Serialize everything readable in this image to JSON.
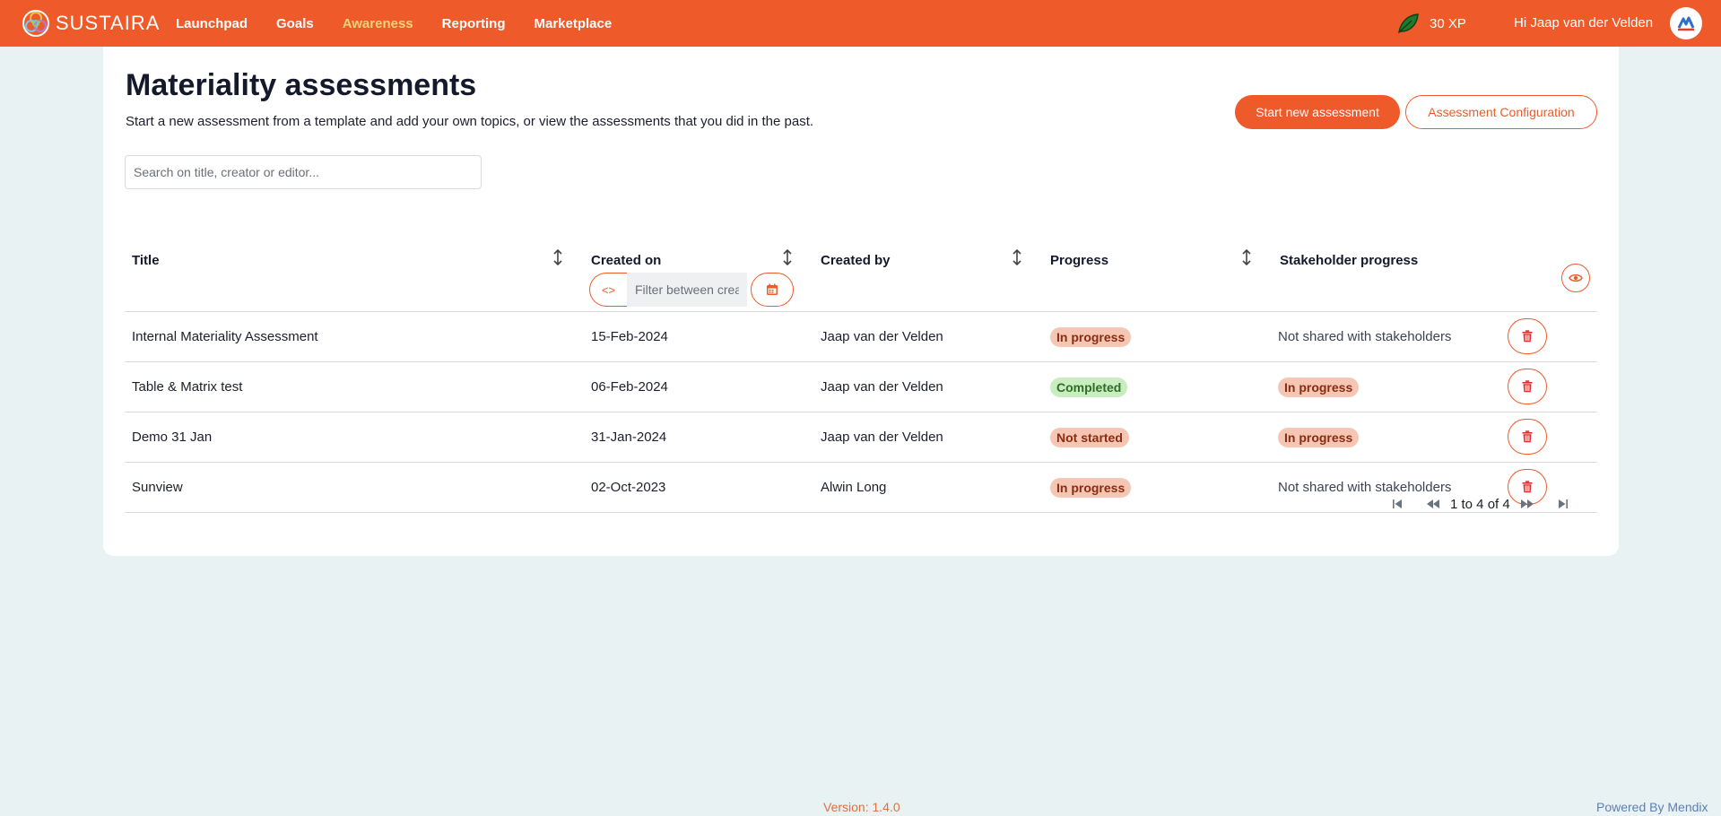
{
  "brand": {
    "name": "SUSTAIRA",
    "logo_icon": "sustaira-logo-icon"
  },
  "nav": {
    "items": [
      {
        "label": "Launchpad",
        "active": false
      },
      {
        "label": "Goals",
        "active": false
      },
      {
        "label": "Awareness",
        "active": true
      },
      {
        "label": "Reporting",
        "active": false
      },
      {
        "label": "Marketplace",
        "active": false
      }
    ]
  },
  "header": {
    "xp": "30 XP",
    "xp_icon": "leaf-icon",
    "greeting": "Hi Jaap van der Velden",
    "avatar_icon": "avatar"
  },
  "page": {
    "title": "Materiality assessments",
    "description": "Start a new assessment from a template and add your own topics, or view the assessments that you did in the past.",
    "primary_button": "Start new assessment",
    "secondary_button": "Assessment Configuration",
    "search_placeholder": "Search on title, creator or editor..."
  },
  "table": {
    "columns": {
      "title": "Title",
      "created_on": "Created on",
      "created_by": "Created by",
      "progress": "Progress",
      "stakeholder_progress": "Stakeholder progress"
    },
    "date_filter_placeholder": "Filter between created dates",
    "date_filter_toggle": "<>",
    "rows": [
      {
        "title": "Internal Materiality Assessment",
        "created_on": "15-Feb-2024",
        "created_by": "Jaap van der Velden",
        "progress": "In progress",
        "progress_status": "in-progress",
        "stakeholder": "Not shared with stakeholders",
        "stakeholder_is_badge": false
      },
      {
        "title": "Table & Matrix test",
        "created_on": "06-Feb-2024",
        "created_by": "Jaap van der Velden",
        "progress": "Completed",
        "progress_status": "completed",
        "stakeholder": "In progress",
        "stakeholder_is_badge": true
      },
      {
        "title": "Demo 31 Jan",
        "created_on": "31-Jan-2024",
        "created_by": "Jaap van der Velden",
        "progress": "Not started",
        "progress_status": "not-started",
        "stakeholder": "In progress",
        "stakeholder_is_badge": true
      },
      {
        "title": "Sunview",
        "created_on": "02-Oct-2023",
        "created_by": "Alwin Long",
        "progress": "In progress",
        "progress_status": "in-progress",
        "stakeholder": "Not shared with stakeholders",
        "stakeholder_is_badge": false
      }
    ]
  },
  "pagination": {
    "text": "1 to 4 of 4"
  },
  "footer": {
    "version": "Version: 1.4.0",
    "powered_by": "Powered By Mendix"
  },
  "colors": {
    "accent": "#ee5a29",
    "background": "#e9f2f2",
    "nav_active": "#f8d27a"
  }
}
